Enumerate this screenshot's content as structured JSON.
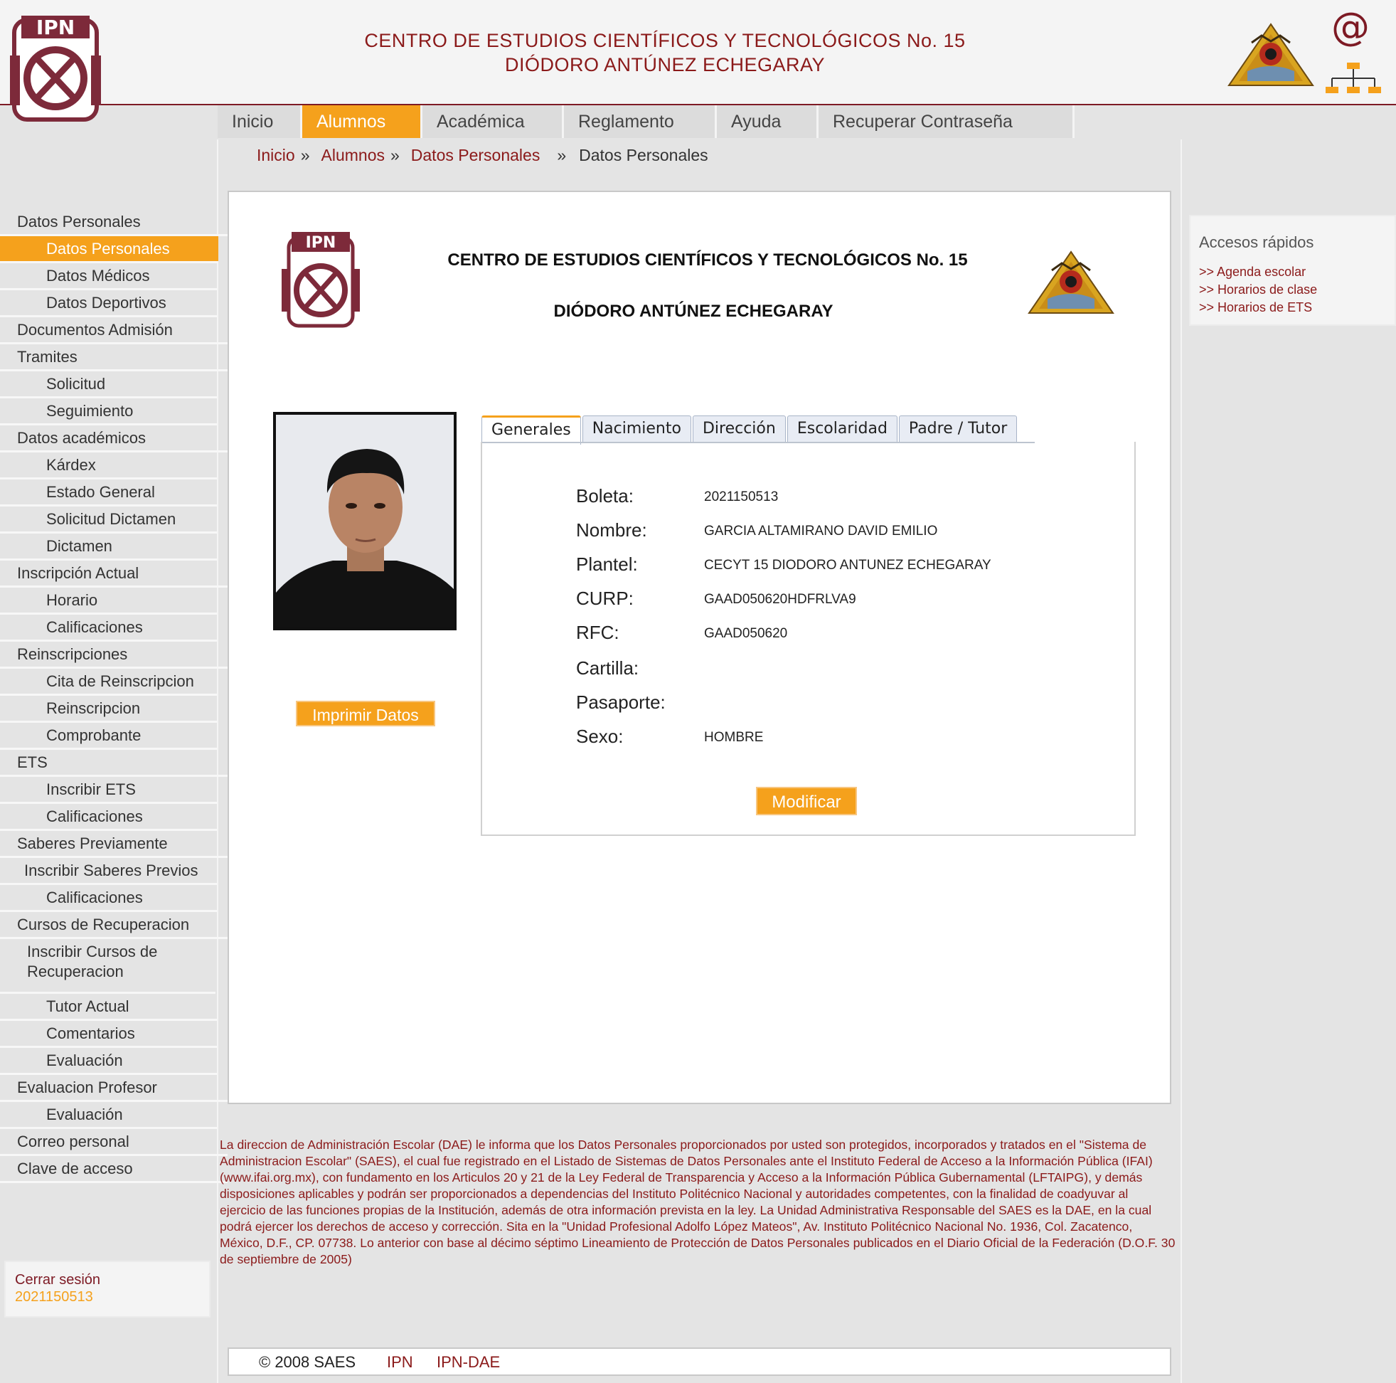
{
  "header": {
    "title_line1": "CENTRO DE ESTUDIOS CIENTÍFICOS Y TECNOLÓGICOS No. 15",
    "title_line2": "DIÓDORO ANTÚNEZ ECHEGARAY",
    "email_icon": "at-sign-icon",
    "sitemap_icon": "sitemap-icon"
  },
  "nav": {
    "items": [
      "Inicio",
      "Alumnos",
      "Académica",
      "Reglamento",
      "Ayuda",
      "Recuperar Contraseña"
    ],
    "active": "Alumnos",
    "active_color": "#f5a11c"
  },
  "breadcrumb": {
    "items": [
      "Inicio",
      "Alumnos",
      "Datos Personales",
      "Datos Personales"
    ],
    "sep": "»"
  },
  "sidebar": {
    "items": [
      {
        "label": "Datos Personales"
      },
      {
        "label": "Datos Personales"
      },
      {
        "label": "Datos Médicos"
      },
      {
        "label": "Datos Deportivos"
      },
      {
        "label": "Documentos Admisión"
      },
      {
        "label": "Tramites"
      },
      {
        "label": "Solicitud"
      },
      {
        "label": "Seguimiento"
      },
      {
        "label": "Datos académicos"
      },
      {
        "label": "Kárdex"
      },
      {
        "label": "Estado General"
      },
      {
        "label": "Solicitud Dictamen"
      },
      {
        "label": "Dictamen"
      },
      {
        "label": "Inscripción Actual"
      },
      {
        "label": "Horario"
      },
      {
        "label": "Calificaciones"
      },
      {
        "label": "Reinscripciones"
      },
      {
        "label": "Cita de Reinscripcion"
      },
      {
        "label": "Reinscripcion"
      },
      {
        "label": "Comprobante"
      },
      {
        "label": "ETS"
      },
      {
        "label": "Inscribir ETS"
      },
      {
        "label": "Calificaciones"
      },
      {
        "label": "Saberes Previamente"
      },
      {
        "label": "Inscribir Saberes Previos"
      },
      {
        "label": "Calificaciones"
      },
      {
        "label": "Cursos de Recuperacion"
      },
      {
        "label": "Inscribir Cursos de Recuperacion"
      },
      {
        "label": "Tutor Actual"
      },
      {
        "label": "Comentarios"
      },
      {
        "label": "Evaluación"
      },
      {
        "label": "Evaluacion Profesor"
      },
      {
        "label": "Evaluación"
      },
      {
        "label": "Correo personal"
      },
      {
        "label": "Clave de acceso"
      }
    ],
    "logout_label": "Cerrar sesión",
    "user_id": "2021150513"
  },
  "main": {
    "title_line1": "CENTRO DE ESTUDIOS CIENTÍFICOS Y TECNOLÓGICOS No. 15",
    "title_line2": "DIÓDORO ANTÚNEZ ECHEGARAY",
    "print_button": "Imprimir Datos",
    "tabs": [
      "Generales",
      "Nacimiento",
      "Dirección",
      "Escolaridad",
      "Padre / Tutor"
    ],
    "active_tab": "Generales",
    "fields": [
      {
        "label": "Boleta:",
        "value": "2021150513"
      },
      {
        "label": "Nombre:",
        "value": "GARCIA ALTAMIRANO DAVID EMILIO"
      },
      {
        "label": "Plantel:",
        "value": "CECYT 15 DIODORO ANTUNEZ ECHEGARAY"
      },
      {
        "label": "CURP:",
        "value": "GAAD050620HDFRLVA9"
      },
      {
        "label": "RFC:",
        "value": "GAAD050620"
      },
      {
        "label": "Cartilla:",
        "value": ""
      },
      {
        "label": "Pasaporte:",
        "value": ""
      },
      {
        "label": "Sexo:",
        "value": "HOMBRE"
      }
    ],
    "modify_button": "Modificar"
  },
  "quick_access": {
    "title": "Accesos rápidos",
    "links": [
      ">> Agenda escolar",
      ">> Horarios de clase",
      ">> Horarios de ETS"
    ]
  },
  "notice": "La direccion de Administración Escolar (DAE) le informa que los Datos Personales proporcionados por usted son protegidos, incorporados y tratados en el \"Sistema de Administracion Escolar\" (SAES), el cual fue registrado en el Listado de Sistemas de Datos Personales ante el Instituto Federal de Acceso a la Información Pública (IFAI) (www.ifai.org.mx), con fundamento en los Articulos 20 y 21 de la Ley Federal de Transparencia y Acceso a la Información Pública Gubernamental (LFTAIPG), y demás disposiciones aplicables y podrán ser proporcionados a dependencias del Instituto Politécnico Nacional y autoridades competentes, con la finalidad de coadyuvar al ejercicio de las funciones propias de la Institución, además de otra información prevista en la ley. La Unidad Administrativa Responsable del SAES es la DAE, en la cual podrá ejercer los derechos de acceso y corrección. Sita en la \"Unidad Profesional Adolfo López Mateos\", Av. Instituto Politécnico Nacional No. 1936, Col. Zacatenco, México, D.F., CP. 07738. Lo anterior con base al décimo séptimo Lineamiento de Protección de Datos Personales publicados en el Diario Oficial de la Federación (D.O.F. 30 de septiembre de 2005)",
  "footer": {
    "copyright": "© 2008 SAES",
    "link_ipn": "IPN",
    "link_dae": "IPN-DAE"
  },
  "colors": {
    "brand_red": "#8b1a1a",
    "accent_orange": "#f5a11c"
  }
}
